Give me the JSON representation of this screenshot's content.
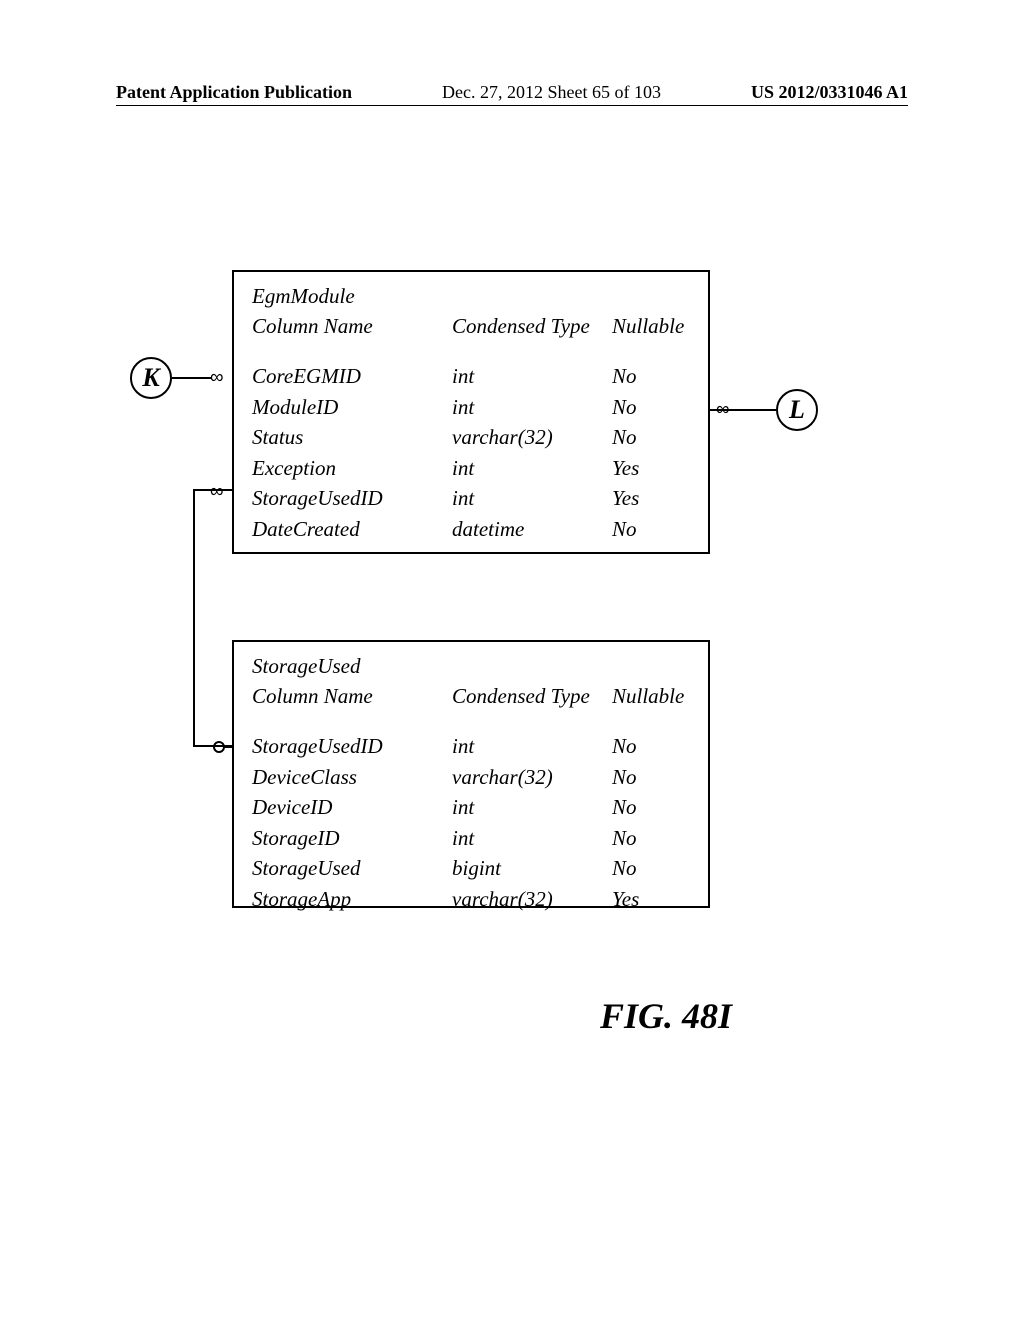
{
  "header": {
    "left": "Patent Application Publication",
    "center": "Dec. 27, 2012  Sheet 65 of 103",
    "right": "US 2012/0331046 A1"
  },
  "labels": {
    "K": "K",
    "L": "L"
  },
  "table1": {
    "title": "EgmModule",
    "col1": "Column Name",
    "col2": "Condensed Type",
    "col3": "Nullable",
    "rows": [
      {
        "name": "CoreEGMID",
        "type": "int",
        "nullable": "No"
      },
      {
        "name": "ModuleID",
        "type": "int",
        "nullable": "No"
      },
      {
        "name": "Status",
        "type": "varchar(32)",
        "nullable": "No"
      },
      {
        "name": "Exception",
        "type": "int",
        "nullable": "Yes"
      },
      {
        "name": "StorageUsedID",
        "type": "int",
        "nullable": "Yes"
      },
      {
        "name": "DateCreated",
        "type": "datetime",
        "nullable": "No"
      }
    ]
  },
  "table2": {
    "title": "StorageUsed",
    "col1": "Column Name",
    "col2": "Condensed Type",
    "col3": "Nullable",
    "rows": [
      {
        "name": "StorageUsedID",
        "type": "int",
        "nullable": "No"
      },
      {
        "name": "DeviceClass",
        "type": "varchar(32)",
        "nullable": "No"
      },
      {
        "name": "DeviceID",
        "type": "int",
        "nullable": "No"
      },
      {
        "name": "StorageID",
        "type": "int",
        "nullable": "No"
      },
      {
        "name": "StorageUsed",
        "type": "bigint",
        "nullable": "No"
      },
      {
        "name": "StorageApp",
        "type": "varchar(32)",
        "nullable": "Yes"
      }
    ]
  },
  "figure": "FIG. 48I"
}
